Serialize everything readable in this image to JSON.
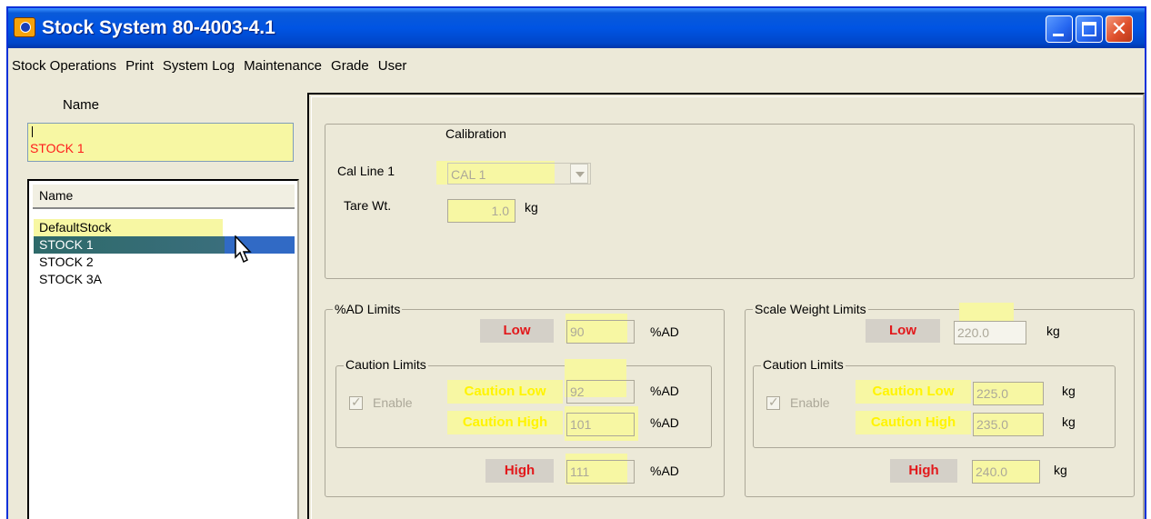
{
  "window": {
    "title": "Stock System 80-4003-4.1"
  },
  "menu": [
    "Stock Operations",
    "Print",
    "System Log",
    "Maintenance",
    "Grade",
    "User"
  ],
  "left": {
    "name_caption": "Name",
    "name_value": "STOCK 1",
    "list_header": "Name",
    "items": [
      "DefaultStock",
      "STOCK 1",
      "STOCK 2",
      "STOCK 3A"
    ],
    "selected": "STOCK 1"
  },
  "calibration": {
    "title": "Calibration",
    "cal_line_label": "Cal Line 1",
    "cal_line_value": "CAL 1",
    "tare_label": "Tare Wt.",
    "tare_value": "1.0",
    "tare_unit": "kg"
  },
  "ad_limits": {
    "title": "%AD  Limits",
    "low_label": "Low",
    "low_value": "90",
    "unit": "%AD",
    "caution_title": "Caution Limits",
    "enable_label": "Enable",
    "caution_low_label": "Caution Low",
    "caution_low_value": "92",
    "caution_high_label": "Caution High",
    "caution_high_value": "101",
    "high_label": "High",
    "high_value": "111"
  },
  "scale_limits": {
    "title": "Scale Weight Limits",
    "low_label": "Low",
    "low_value": "220.0",
    "unit": "kg",
    "caution_title": "Caution Limits",
    "enable_label": "Enable",
    "caution_low_label": "Caution Low",
    "caution_low_value": "225.0",
    "caution_high_label": "Caution High",
    "caution_high_value": "235.0",
    "high_label": "High",
    "high_value": "240.0"
  },
  "colors": {
    "titlebar": "#0054e3",
    "alert_red": "#e2181b",
    "highlight_yellow": "#f7f7a3",
    "selection": "#316ac5"
  }
}
